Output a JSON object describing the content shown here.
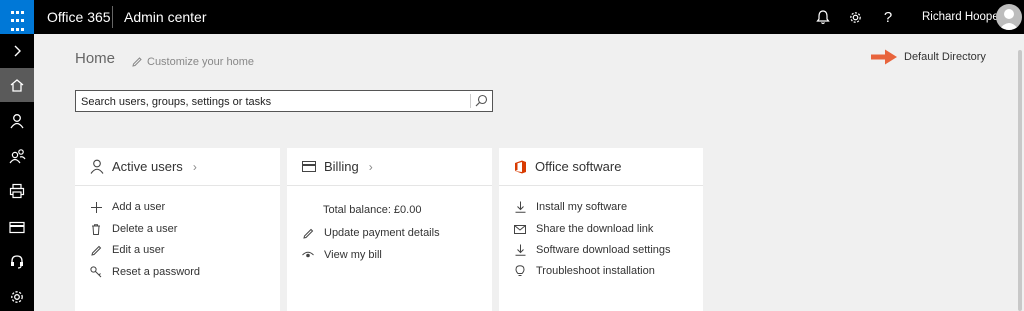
{
  "topbar": {
    "brand": "Office 365",
    "app_title": "Admin center",
    "user_name": "Richard Hooper",
    "icons": [
      "bell-icon",
      "gear-icon",
      "help-icon"
    ]
  },
  "nav": {
    "items": [
      "expand",
      "home",
      "users",
      "groups",
      "resources",
      "billing",
      "support",
      "settings"
    ],
    "active": "home"
  },
  "page": {
    "title": "Home",
    "customize_label": "Customize your home",
    "directory_label": "Default Directory"
  },
  "search": {
    "placeholder": "Search users, groups, settings or tasks"
  },
  "cards": {
    "active_users": {
      "title": "Active users",
      "items": [
        "Add a user",
        "Delete a user",
        "Edit a user",
        "Reset a password"
      ]
    },
    "billing": {
      "title": "Billing",
      "balance": "Total balance: £0.00",
      "items": [
        "Update payment details",
        "View my bill"
      ]
    },
    "office_software": {
      "title": "Office software",
      "items": [
        "Install my software",
        "Share the download link",
        "Software download settings",
        "Troubleshoot installation"
      ]
    }
  },
  "colors": {
    "accent": "#0078d7",
    "annotation_arrow": "#e8643c",
    "office_logo": "#d83b01"
  }
}
